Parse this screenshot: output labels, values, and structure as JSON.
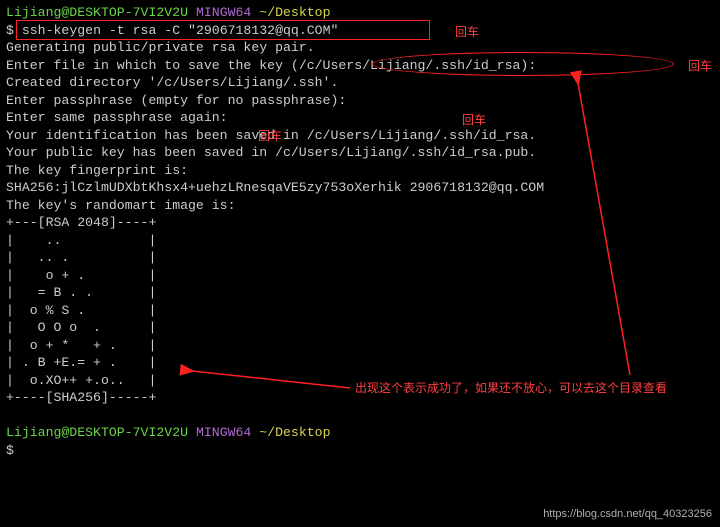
{
  "prompt1": {
    "user": "Lijiang@DESKTOP-7VI2V2U",
    "env": "MINGW64",
    "path": "~/Desktop",
    "symbol": "$",
    "command": "ssh-keygen -t rsa -C \"2906718132@qq.COM\""
  },
  "output": {
    "l1": "Generating public/private rsa key pair.",
    "l2a": "Enter file in which to save the key (",
    "l2b": "/c/Users/Lijiang/.ssh/id_rsa",
    "l2c": "):",
    "l3": "Created directory '/c/Users/Lijiang/.ssh'.",
    "l4": "Enter passphrase (empty for no passphrase):",
    "l5": "Enter same passphrase again:",
    "l6": "Your identification has been saved in /c/Users/Lijiang/.ssh/id_rsa.",
    "l7": "Your public key has been saved in /c/Users/Lijiang/.ssh/id_rsa.pub.",
    "l8": "The key fingerprint is:",
    "l9": "SHA256:jlCzlmUDXbtKhsx4+uehzLRnesqaVE5zy753oXerhik 2906718132@qq.COM",
    "l10": "The key's randomart image is:",
    "r1": "+---[RSA 2048]----+",
    "r2": "|    ..           |",
    "r3": "|   .. .          |",
    "r4": "|    o + .        |",
    "r5": "|   = B . .       |",
    "r6": "|  o % S .        |",
    "r7": "|   O O o  .      |",
    "r8": "|  o + *   + .    |",
    "r9": "| . B +E.= + .    |",
    "r10": "|  o.XO++ +.o..   |",
    "r11": "+----[SHA256]-----+"
  },
  "prompt2": {
    "user": "Lijiang@DESKTOP-7VI2V2U",
    "env": "MINGW64",
    "path": "~/Desktop",
    "symbol": "$"
  },
  "annotations": {
    "enter1": "回车",
    "enter2": "回车",
    "enter3": "回车",
    "enter4": "回车",
    "success_msg": "出现这个表示成功了，如果还不放心，可以去这个目录查看"
  },
  "watermark": "https://blog.csdn.net/qq_40323256"
}
